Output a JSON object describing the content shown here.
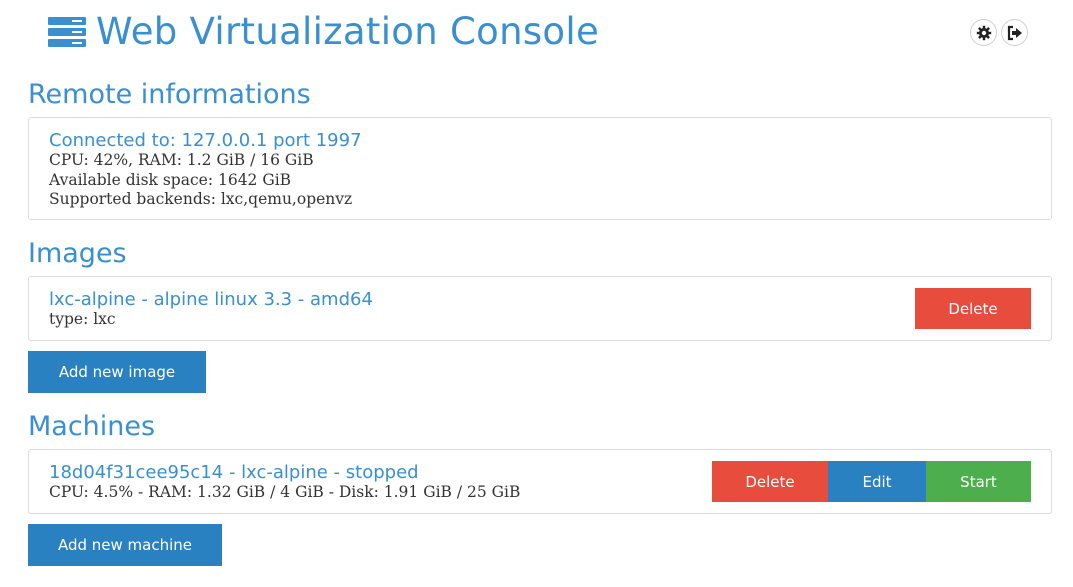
{
  "header": {
    "title": "Web Virtualization Console",
    "logo_icon": "server-stack-icon",
    "settings_icon": "gear-icon",
    "logout_icon": "sign-out-icon"
  },
  "remote": {
    "section_title": "Remote informations",
    "connected": "Connected to: 127.0.0.1 port 1997",
    "cpu_ram": "CPU: 42%, RAM: 1.2 GiB / 16 GiB",
    "disk": "Available disk space: 1642 GiB",
    "backends": "Supported backends: lxc,qemu,openvz"
  },
  "images": {
    "section_title": "Images",
    "items": [
      {
        "name": "lxc-alpine - alpine linux 3.3 - amd64",
        "type": "type: lxc",
        "delete_label": "Delete"
      }
    ],
    "add_label": "Add new image"
  },
  "machines": {
    "section_title": "Machines",
    "items": [
      {
        "name": "18d04f31cee95c14 - lxc-alpine - stopped",
        "stats": "CPU: 4.5% - RAM: 1.32 GiB / 4 GiB - Disk: 1.91 GiB / 25 GiB",
        "delete_label": "Delete",
        "edit_label": "Edit",
        "start_label": "Start"
      }
    ],
    "add_label": "Add new machine"
  },
  "colors": {
    "accent": "#3a8fd0",
    "danger": "#e74c3c",
    "primary": "#2a81c2",
    "success": "#4cae4c"
  }
}
